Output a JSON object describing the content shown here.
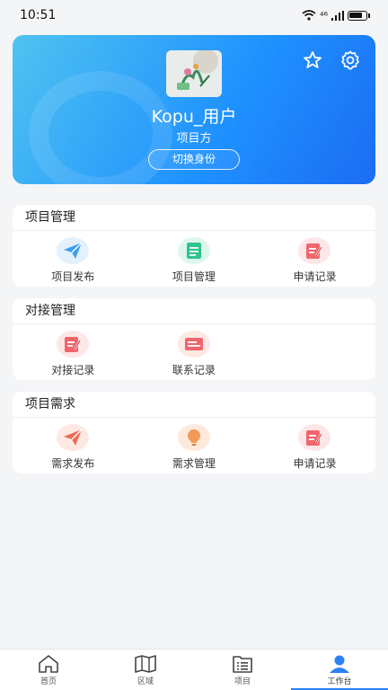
{
  "status": {
    "time": "10:51",
    "signal_text": "⁴⁶"
  },
  "profile": {
    "username": "Kopu_用户",
    "role": "项目方",
    "switch_label": "切换身份"
  },
  "sections": [
    {
      "title": "项目管理",
      "items": [
        {
          "label": "项目发布",
          "icon": "paper-plane-icon",
          "color": "#3d9ef0"
        },
        {
          "label": "项目管理",
          "icon": "document-list-icon",
          "color": "#2fc48c"
        },
        {
          "label": "申请记录",
          "icon": "edit-record-icon",
          "color": "#f0656c"
        }
      ]
    },
    {
      "title": "对接管理",
      "items": [
        {
          "label": "对接记录",
          "icon": "edit-record-icon",
          "color": "#f0656c"
        },
        {
          "label": "联系记录",
          "icon": "ticket-icon",
          "color": "#f0656c"
        }
      ]
    },
    {
      "title": "项目需求",
      "items": [
        {
          "label": "需求发布",
          "icon": "paper-plane-icon",
          "color": "#f06a52"
        },
        {
          "label": "需求管理",
          "icon": "lightbulb-icon",
          "color": "#f29a55"
        },
        {
          "label": "申请记录",
          "icon": "edit-record-icon",
          "color": "#f0656c"
        }
      ]
    }
  ],
  "tabs": [
    {
      "label": "首页",
      "icon": "home-icon"
    },
    {
      "label": "区域",
      "icon": "map-icon"
    },
    {
      "label": "项目",
      "icon": "list-icon"
    },
    {
      "label": "工作台",
      "icon": "user-icon",
      "active": true
    }
  ]
}
